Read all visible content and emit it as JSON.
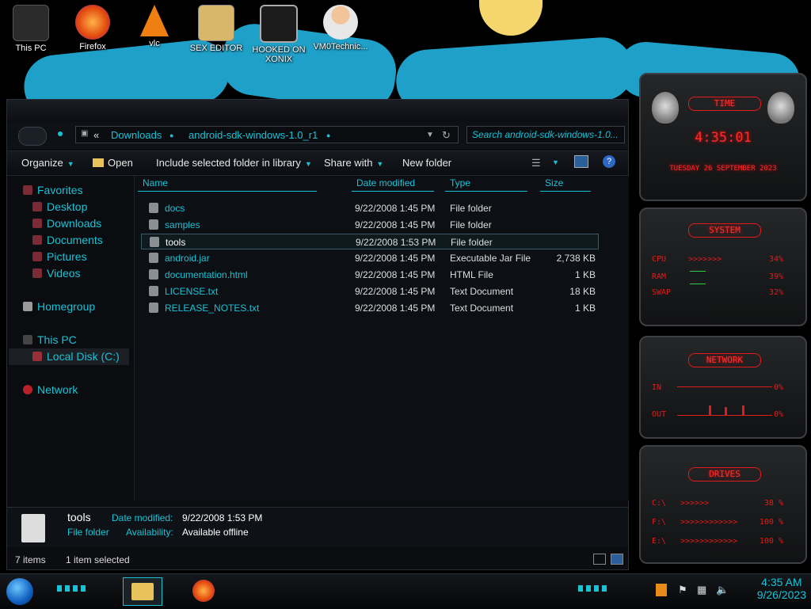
{
  "desktop": {
    "icons": [
      {
        "label": "This PC",
        "icon": "computer-icon"
      },
      {
        "label": "Firefox",
        "icon": "firefox-icon"
      },
      {
        "label": "vlc",
        "icon": "vlc-icon"
      },
      {
        "label": "SEX EDITOR",
        "icon": "hex-editor-icon"
      },
      {
        "label": "HOOKED ON XONIX",
        "icon": "game-icon"
      },
      {
        "label": "VM0Technic...",
        "icon": "user-icon"
      }
    ]
  },
  "explorer": {
    "address": {
      "chevron": "«",
      "segments": [
        "Downloads",
        "android-sdk-windows-1.0_r1"
      ]
    },
    "search_placeholder": "Search android-sdk-windows-1.0...",
    "toolbar": {
      "organize": "Organize",
      "open": "Open",
      "include": "Include selected folder in library",
      "share": "Share with",
      "new_folder": "New folder"
    },
    "nav": {
      "favorites": "Favorites",
      "desktop": "Desktop",
      "downloads": "Downloads",
      "documents": "Documents",
      "pictures": "Pictures",
      "videos": "Videos",
      "homegroup": "Homegroup",
      "this_pc": "This PC",
      "local_disk": "Local Disk (C:)",
      "network": "Network"
    },
    "columns": {
      "name": "Name",
      "date": "Date modified",
      "type": "Type",
      "size": "Size"
    },
    "files": [
      {
        "name": "docs",
        "date": "9/22/2008 1:45 PM",
        "type": "File folder",
        "size": ""
      },
      {
        "name": "samples",
        "date": "9/22/2008 1:45 PM",
        "type": "File folder",
        "size": ""
      },
      {
        "name": "tools",
        "date": "9/22/2008 1:53 PM",
        "type": "File folder",
        "size": ""
      },
      {
        "name": "android.jar",
        "date": "9/22/2008 1:45 PM",
        "type": "Executable Jar File",
        "size": "2,738 KB"
      },
      {
        "name": "documentation.html",
        "date": "9/22/2008 1:45 PM",
        "type": "HTML File",
        "size": "1 KB"
      },
      {
        "name": "LICENSE.txt",
        "date": "9/22/2008 1:45 PM",
        "type": "Text Document",
        "size": "18 KB"
      },
      {
        "name": "RELEASE_NOTES.txt",
        "date": "9/22/2008 1:45 PM",
        "type": "Text Document",
        "size": "1 KB"
      }
    ],
    "details": {
      "name": "tools",
      "kind": "File folder",
      "date_label": "Date modified:",
      "date_value": "9/22/2008 1:53 PM",
      "avail_label": "Availability:",
      "avail_value": "Available offline"
    },
    "status": {
      "items": "7 items",
      "selected": "1 item selected"
    }
  },
  "gadgets": {
    "time": {
      "title": "TIME",
      "clock": "4:35:01",
      "date": "TUESDAY 26 SEPTEMBER 2023"
    },
    "system": {
      "title": "SYSTEM",
      "rows": [
        {
          "label": "CPU",
          "value": "34%"
        },
        {
          "label": "RAM",
          "value": "39%"
        },
        {
          "label": "SWAP",
          "value": "32%"
        }
      ]
    },
    "network": {
      "title": "NETWORK",
      "rows": [
        {
          "label": "IN",
          "value": "0%"
        },
        {
          "label": "OUT",
          "value": "0%"
        }
      ]
    },
    "drives": {
      "title": "DRIVES",
      "rows": [
        {
          "label": "C:\\",
          "value": "38 %"
        },
        {
          "label": "F:\\",
          "value": "100 %"
        },
        {
          "label": "E:\\",
          "value": "100 %"
        }
      ]
    }
  },
  "taskbar": {
    "time": "4:35 AM",
    "date": "9/26/2023"
  },
  "colors": {
    "accent": "#19c3d6",
    "gadget_red": "#e31b1b"
  }
}
